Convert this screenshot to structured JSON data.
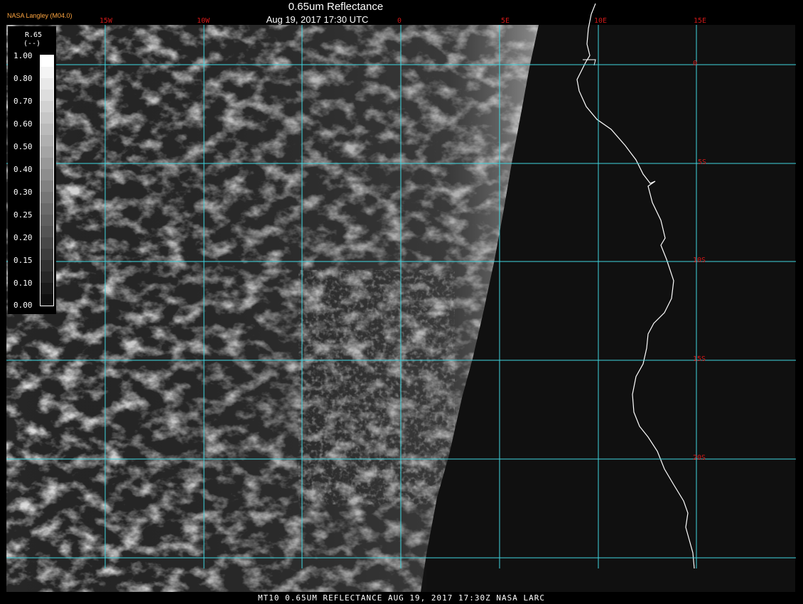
{
  "header": {
    "title": "0.65um Reflectance",
    "subtitle": "Aug 19, 2017 17:30 UTC",
    "brand": "NASA Langley (M04.0)"
  },
  "map": {
    "lon_labels": [
      "15W",
      "10W",
      "0",
      "5E",
      "10E",
      "15E"
    ],
    "lat_labels": [
      "0",
      "5S",
      "10S",
      "15S",
      "20S"
    ],
    "grid_color": "#3fd6e0",
    "label_color": "#d01818"
  },
  "legend": {
    "variable": "R.65",
    "unit": "(--)",
    "ticks": [
      "1.00",
      "0.80",
      "0.70",
      "0.60",
      "0.50",
      "0.40",
      "0.30",
      "0.25",
      "0.20",
      "0.15",
      "0.10",
      "0.00"
    ]
  },
  "footer": {
    "text": "MT10  0.65UM REFLECTANCE   AUG 19, 2017 17:30Z   NASA LARC"
  }
}
